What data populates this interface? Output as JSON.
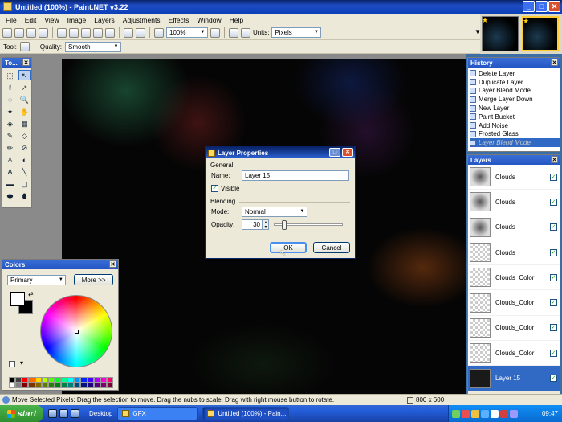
{
  "window": {
    "title": "Untitled (100%) - Paint.NET v3.22",
    "minimize": "_",
    "maximize": "□",
    "close": "✕"
  },
  "menu": [
    "File",
    "Edit",
    "View",
    "Image",
    "Layers",
    "Adjustments",
    "Effects",
    "Window",
    "Help"
  ],
  "toolbar": {
    "zoom": "100%",
    "units_label": "Units:",
    "units_value": "Pixels"
  },
  "toolbar2": {
    "tool_label": "Tool:",
    "quality_label": "Quality:",
    "quality_value": "Smooth"
  },
  "tools_panel": {
    "title": "To..."
  },
  "colors_panel": {
    "title": "Colors",
    "mode": "Primary",
    "more_button": "More >>",
    "primary_color": "#ffffff",
    "secondary_color": "#000000"
  },
  "history_panel": {
    "title": "History",
    "items": [
      "Delete Layer",
      "Duplicate Layer",
      "Layer Blend Mode",
      "Merge Layer Down",
      "New Layer",
      "Paint Bucket",
      "Add Noise",
      "Frosted Glass",
      "Layer Blend Mode"
    ]
  },
  "layers_panel": {
    "title": "Layers",
    "layers": [
      {
        "name": "Clouds",
        "visible": true,
        "thumb": "cloud"
      },
      {
        "name": "Clouds",
        "visible": true,
        "thumb": "cloud"
      },
      {
        "name": "Clouds",
        "visible": true,
        "thumb": "cloud"
      },
      {
        "name": "Clouds",
        "visible": true,
        "thumb": "checker"
      },
      {
        "name": "Clouds_Color",
        "visible": true,
        "thumb": "checker"
      },
      {
        "name": "Clouds_Color",
        "visible": true,
        "thumb": "checker"
      },
      {
        "name": "Clouds_Color",
        "visible": true,
        "thumb": "checker"
      },
      {
        "name": "Clouds_Color",
        "visible": true,
        "thumb": "checker"
      },
      {
        "name": "Layer 15",
        "visible": true,
        "thumb": "dark",
        "selected": true
      }
    ]
  },
  "dialog": {
    "title": "Layer Properties",
    "general_label": "General",
    "name_label": "Name:",
    "name_value": "Layer 15",
    "visible_label": "Visible",
    "blending_label": "Blending",
    "mode_label": "Mode:",
    "mode_value": "Normal",
    "opacity_label": "Opacity:",
    "opacity_value": "30",
    "opacity_fraction": 0.118,
    "ok_label": "OK",
    "cancel_label": "Cancel"
  },
  "status": {
    "message": "Move Selected Pixels: Drag the selection to move. Drag the nubs to scale. Drag with right mouse button to rotate.",
    "image_size": "800 x 600"
  },
  "taskbar": {
    "start": "start",
    "desktop_label": "Desktop",
    "tasks": [
      "GFX",
      "Untitled (100%) - Pain..."
    ],
    "clock": "09:47"
  }
}
